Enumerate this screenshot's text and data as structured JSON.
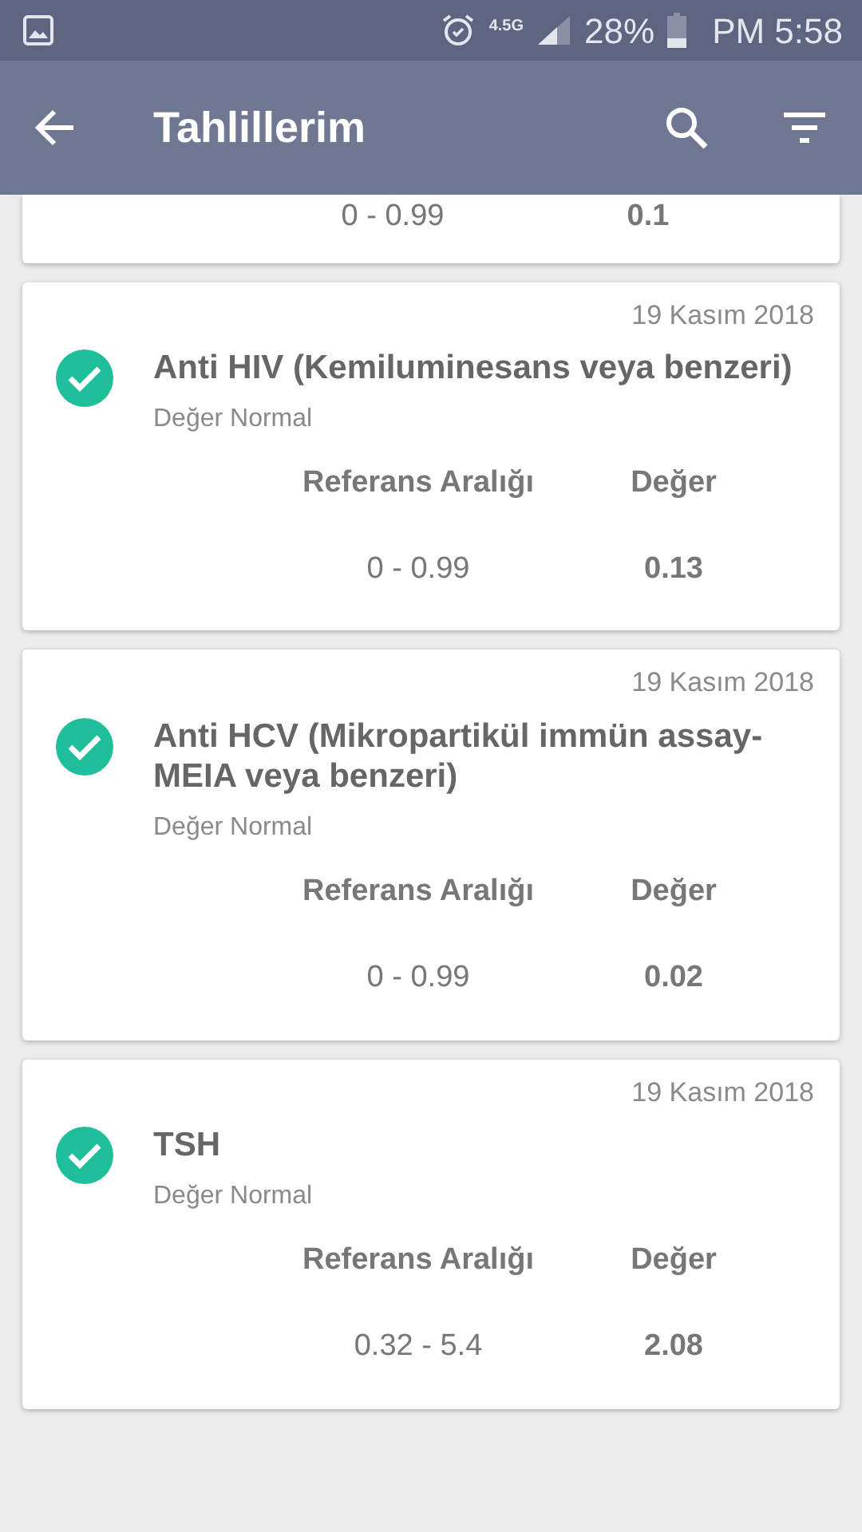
{
  "status_bar": {
    "network": "4.5G",
    "battery": "28%",
    "time": "PM 5:58"
  },
  "app_bar": {
    "title": "Tahlillerim"
  },
  "partial_card": {
    "range": "0 - 0.99",
    "value": "0.1"
  },
  "results": [
    {
      "date": "19 Kasım 2018",
      "name": "Anti HIV (Kemiluminesans veya benzeri)",
      "status": "Değer Normal",
      "normal": true,
      "range_header": "Referans Aralığı",
      "value_header": "Değer",
      "range": "0 - 0.99",
      "value": "0.13"
    },
    {
      "date": "19 Kasım 2018",
      "name": "Anti HCV (Mikropartikül immün assay-MEIA veya benzeri)",
      "status": "Değer Normal",
      "normal": true,
      "range_header": "Referans Aralığı",
      "value_header": "Değer",
      "range": "0 - 0.99",
      "value": "0.02"
    },
    {
      "date": "19 Kasım 2018",
      "name": "TSH",
      "status": "Değer Normal",
      "normal": true,
      "range_header": "Referans Aralığı",
      "value_header": "Değer",
      "range": "0.32 - 5.4",
      "value": "2.08"
    }
  ]
}
